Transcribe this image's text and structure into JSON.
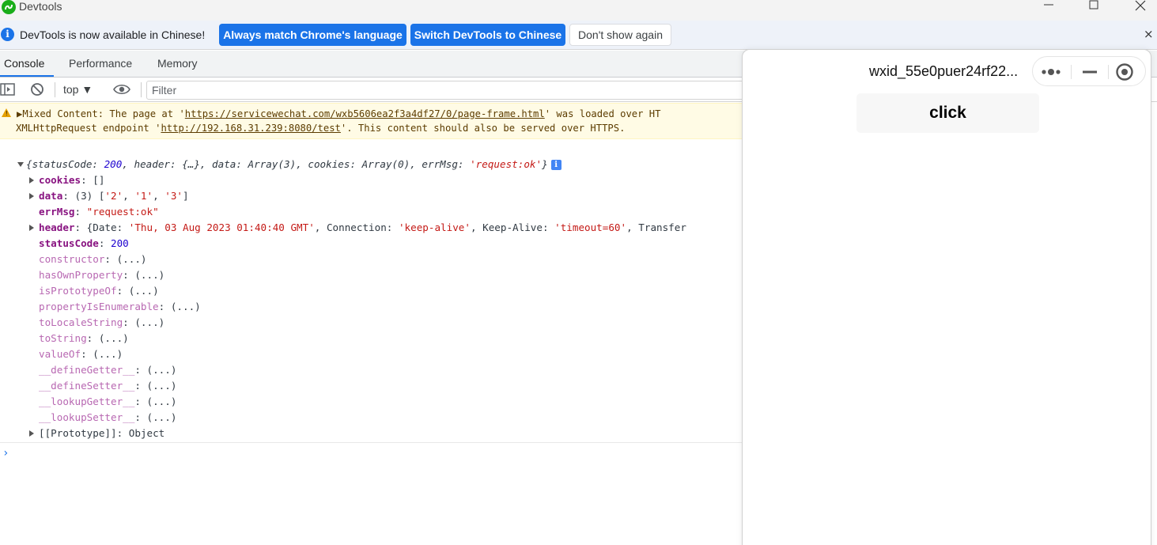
{
  "window": {
    "title": "Devtools"
  },
  "infobar": {
    "message": "DevTools is now available in Chinese!",
    "btn_match": "Always match Chrome's language",
    "btn_switch": "Switch DevTools to Chinese",
    "btn_dismiss": "Don't show again",
    "close": "×"
  },
  "tabs": {
    "console": "Console",
    "performance": "Performance",
    "memory": "Memory"
  },
  "toolbar": {
    "context": "top ▼",
    "filter_placeholder": "Filter"
  },
  "warning": {
    "prefix": "▶Mixed Content: The page at '",
    "page_url": "https://servicewechat.com/wxb5606ea2f3a4df27/0/page-frame.html",
    "mid": "' was loaded over HT",
    "line2_prefix": "XMLHttpRequest endpoint '",
    "endpoint_url": "http://192.168.31.239:8080/test",
    "line2_suffix": "'. This content should also be served over HTTPS."
  },
  "log": {
    "summary": {
      "open": "{statusCode: ",
      "status": "200",
      "mid1": ", header: {…}, data: Array(3), cookies: Array(0), errMsg: ",
      "errmsg": "'request:ok'",
      "close": "}",
      "badge": "i"
    },
    "cookies": {
      "key": "cookies",
      "value": ": []"
    },
    "data": {
      "key": "data",
      "pre": ": (3) [",
      "v1": "'2'",
      "c1": ", ",
      "v2": "'1'",
      "c2": ", ",
      "v3": "'3'",
      "post": "]"
    },
    "errMsg": {
      "key": "errMsg",
      "sep": ": ",
      "value": "\"request:ok\""
    },
    "header": {
      "key": "header",
      "open": ": {Date: ",
      "date": "'Thu, 03 Aug 2023 01:40:40 GMT'",
      "conn_label": ", Connection: ",
      "conn": "'keep-alive'",
      "ka_label": ", Keep-Alive: ",
      "ka": "'timeout=60'",
      "tail": ", Transfer"
    },
    "statusCode": {
      "key": "statusCode",
      "sep": ": ",
      "value": "200"
    },
    "proto_methods": [
      "constructor",
      "hasOwnProperty",
      "isPrototypeOf",
      "propertyIsEnumerable",
      "toLocaleString",
      "toString",
      "valueOf",
      "__defineGetter__",
      "__defineSetter__",
      "__lookupGetter__",
      "__lookupSetter__"
    ],
    "ellipsis": ": (...)",
    "prototype": {
      "key": "[[Prototype]]",
      "value": ": Object"
    },
    "prompt": "›"
  },
  "simulator": {
    "title": "wxid_55e0puer24rf22...",
    "click_label": "click"
  },
  "colors": {
    "accent": "#1a73e8",
    "warning_bg": "#fffbe5",
    "string": "#c41a16",
    "number": "#1c00cf",
    "own_key": "#881280",
    "proto_key": "#b868b2"
  }
}
